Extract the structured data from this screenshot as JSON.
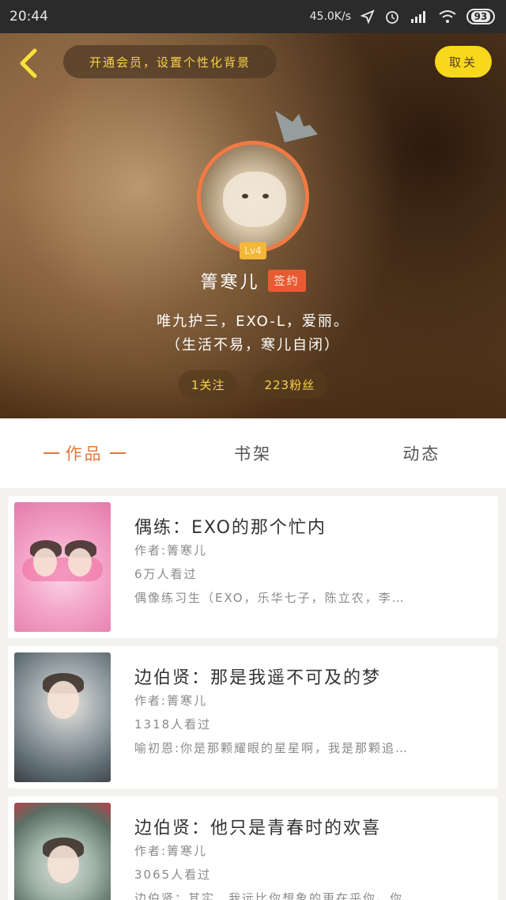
{
  "status_bar": {
    "time": "20:44",
    "net_speed": "45.0K/s",
    "battery": "93"
  },
  "header": {
    "vip_banner": "开通会员，设置个性化背景",
    "close_label": "取关",
    "level": "Lv4",
    "username": "箐寒儿",
    "signed_label": "签约",
    "bio_line1": "唯九护三，EXO-L，爱丽。",
    "bio_line2": "（生活不易，寒儿自闭）",
    "following": "1关注",
    "followers": "223粉丝"
  },
  "tabs": [
    {
      "label": "作品",
      "active": true
    },
    {
      "label": "书架",
      "active": false
    },
    {
      "label": "动态",
      "active": false
    }
  ],
  "books": [
    {
      "title": "偶练：EXO的那个忙内",
      "author": "作者:箐寒儿",
      "views": "6万人看过",
      "desc": "偶像练习生（EXO，乐华七子，陈立农，李…"
    },
    {
      "title": "边伯贤：那是我遥不可及的梦",
      "author": "作者:箐寒儿",
      "views": "1318人看过",
      "desc": "喻初恩:你是那颗耀眼的星星啊，我是那颗追…"
    },
    {
      "title": "边伯贤：他只是青春时的欢喜",
      "author": "作者:箐寒儿",
      "views": "3065人看过",
      "desc": "边伯贤：其实，我远比你想象的更在乎你。你…"
    }
  ],
  "colors": {
    "accent": "#e2773f",
    "vip_yellow": "#f7d24a",
    "close_button": "#f7d81c",
    "signed_badge": "#ea5a32"
  }
}
